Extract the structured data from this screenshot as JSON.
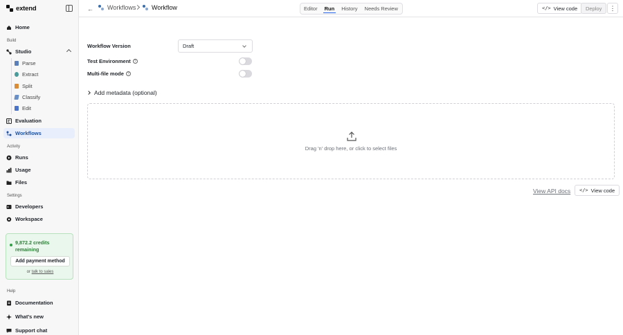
{
  "brand": {
    "name": "extend"
  },
  "sidebar": {
    "home": "Home",
    "build_label": "Build",
    "studio": "Studio",
    "studio_items": [
      {
        "label": "Parse",
        "icon": "parse-icon",
        "color": "#5b7fb8"
      },
      {
        "label": "Extract",
        "icon": "extract-icon",
        "color": "#4a9b9b"
      },
      {
        "label": "Split",
        "icon": "split-icon",
        "color": "#d98c3a"
      },
      {
        "label": "Classify",
        "icon": "classify-icon",
        "color": "#6a8fc7"
      },
      {
        "label": "Edit",
        "icon": "edit-icon",
        "color": "#4b74c9"
      }
    ],
    "evaluation": "Evaluation",
    "workflows": "Workflows",
    "activity_label": "Activity",
    "runs": "Runs",
    "usage": "Usage",
    "files": "Files",
    "settings_label": "Settings",
    "developers": "Developers",
    "workspace": "Workspace",
    "help_label": "Help",
    "documentation": "Documentation",
    "whats_new": "What's new",
    "support_chat": "Support chat"
  },
  "credits": {
    "text": "9,872.2 credits remaining",
    "add_payment": "Add payment method",
    "or": "or",
    "talk_to_sales": "talk to sales"
  },
  "topbar": {
    "breadcrumb_parent": "Workflows",
    "breadcrumb_current": "Workflow",
    "tabs": [
      "Editor",
      "Run",
      "History",
      "Needs Review"
    ],
    "active_tab": "Run",
    "view_code": "View code",
    "deploy": "Deploy"
  },
  "form": {
    "workflow_version_label": "Workflow Version",
    "workflow_version_value": "Draft",
    "test_environment_label": "Test Environment",
    "multi_file_label": "Multi-file mode",
    "test_environment_on": false,
    "multi_file_on": false,
    "metadata_label": "Add metadata (optional)"
  },
  "dropzone": {
    "text": "Drag 'n' drop here, or click to select files"
  },
  "footer": {
    "api_docs": "View API docs",
    "view_code": "View code"
  },
  "colors": {
    "accent": "#2563eb",
    "active_nav_bg": "#e8eefb",
    "credits_bg": "#eaf7ec",
    "credits_text": "#2f7d3a"
  }
}
